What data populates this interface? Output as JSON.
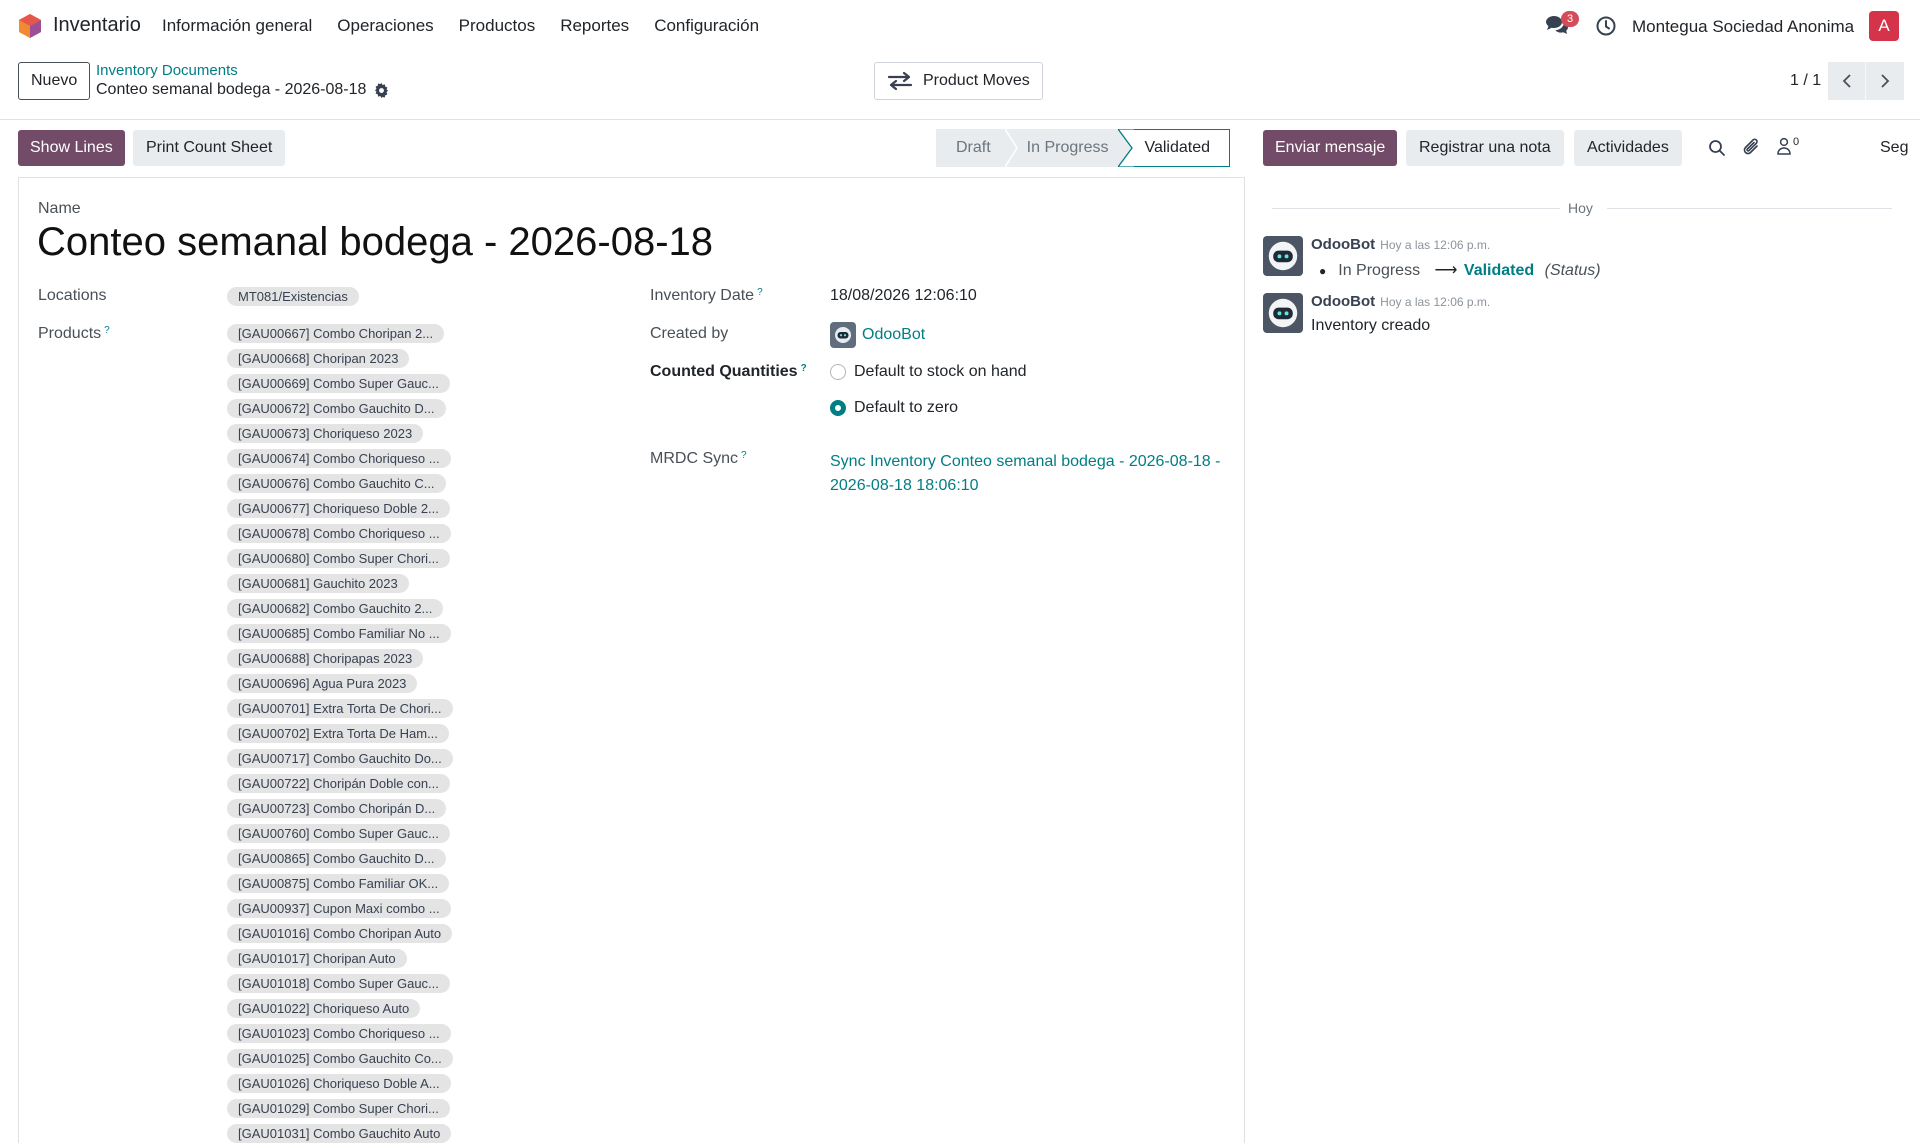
{
  "navbar": {
    "app_name": "Inventario",
    "menu": [
      "Información general",
      "Operaciones",
      "Productos",
      "Reportes",
      "Configuración"
    ],
    "chat_badge": "3",
    "company": "Montegua Sociedad Anonima",
    "user_initial": "A"
  },
  "control": {
    "new_button": "Nuevo",
    "breadcrumb_parent": "Inventory Documents",
    "breadcrumb_current": "Conteo semanal bodega - 2026-08-18",
    "product_moves": "Product Moves",
    "pager": "1 / 1"
  },
  "actions": {
    "show_lines": "Show Lines",
    "print_count_sheet": "Print Count Sheet"
  },
  "statusbar": {
    "stages": [
      "Draft",
      "In Progress",
      "Validated"
    ],
    "active": "Validated"
  },
  "chatter_actions": {
    "send_message": "Enviar mensaje",
    "log_note": "Registrar una nota",
    "activities": "Actividades",
    "followers_count": "0",
    "follow_label": "Seg"
  },
  "form": {
    "name_label": "Name",
    "name_value": "Conteo semanal bodega - 2026-08-18",
    "locations_label": "Locations",
    "location_tag": "MT081/Existencias",
    "products_label": "Products",
    "products": [
      "[GAU00667] Combo Choripan 2...",
      "[GAU00668] Choripan 2023",
      "[GAU00669] Combo Super Gauc...",
      "[GAU00672] Combo Gauchito D...",
      "[GAU00673] Choriqueso 2023",
      "[GAU00674] Combo Choriqueso ...",
      "[GAU00676] Combo Gauchito C...",
      "[GAU00677] Choriqueso Doble 2...",
      "[GAU00678] Combo Choriqueso ...",
      "[GAU00680] Combo Super Chori...",
      "[GAU00681] Gauchito 2023",
      "[GAU00682] Combo Gauchito 2...",
      "[GAU00685] Combo Familiar No ...",
      "[GAU00688] Choripapas 2023",
      "[GAU00696] Agua Pura 2023",
      "[GAU00701] Extra Torta De Chori...",
      "[GAU00702] Extra Torta De Ham...",
      "[GAU00717] Combo Gauchito Do...",
      "[GAU00722] Choripán Doble con...",
      "[GAU00723] Combo Choripán D...",
      "[GAU00760] Combo Super Gauc...",
      "[GAU00865] Combo Gauchito D...",
      "[GAU00875] Combo Familiar OK...",
      "[GAU00937] Cupon Maxi combo ...",
      "[GAU01016] Combo Choripan Auto",
      "[GAU01017] Choripan Auto",
      "[GAU01018] Combo Super Gauc...",
      "[GAU01022] Choriqueso Auto",
      "[GAU01023] Combo Choriqueso ...",
      "[GAU01025] Combo Gauchito Co...",
      "[GAU01026] Choriqueso Doble A...",
      "[GAU01029] Combo Super Chori...",
      "[GAU01031] Combo Gauchito Auto"
    ],
    "inventory_date_label": "Inventory Date",
    "inventory_date": "18/08/2026 12:06:10",
    "created_by_label": "Created by",
    "created_by": "OdooBot",
    "counted_label": "Counted Quantities",
    "counted_options": [
      "Default to stock on hand",
      "Default to zero"
    ],
    "counted_selected": "Default to zero",
    "mrdc_label": "MRDC Sync",
    "mrdc_value": "Sync Inventory Conteo semanal bodega - 2026-08-18 - 2026-08-18 18:06:10",
    "help_mark": "?"
  },
  "chatter": {
    "day_separator": "Hoy",
    "messages": [
      {
        "author": "OdooBot",
        "time": "Hoy a las 12:06 p.m.",
        "old_value": "In Progress",
        "arrow": "⟶",
        "new_value": "Validated",
        "field": "(Status)"
      },
      {
        "author": "OdooBot",
        "time": "Hoy a las 12:06 p.m.",
        "body": "Inventory creado"
      }
    ]
  },
  "colors": {
    "brand": "#714b67",
    "accent": "#017e84",
    "badge": "#d44c59",
    "avatar": "#d4334a"
  }
}
